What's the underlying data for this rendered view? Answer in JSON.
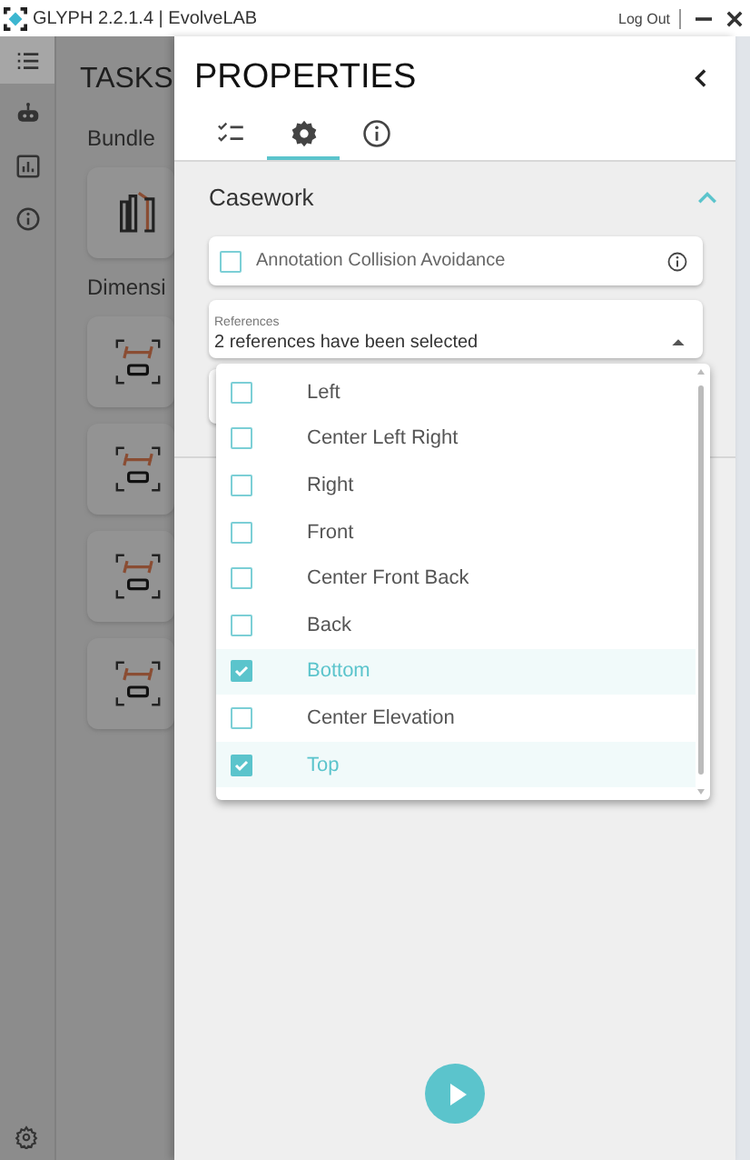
{
  "window": {
    "title": "GLYPH 2.2.1.4 | EvolveLAB",
    "logout": "Log Out"
  },
  "tasks_panel": {
    "title": "TASKS",
    "sections": [
      {
        "title": "Bundle",
        "cards": [
          {
            "kind": "bundle"
          }
        ]
      },
      {
        "title": "Dimensi",
        "cards": [
          {
            "kind": "dimension"
          },
          {
            "kind": "dimension"
          },
          {
            "kind": "dimension"
          },
          {
            "kind": "dimension"
          }
        ]
      }
    ]
  },
  "rail": {
    "items": [
      {
        "kind": "list",
        "selected": true
      },
      {
        "kind": "robot",
        "selected": false
      },
      {
        "kind": "chart",
        "selected": false
      },
      {
        "kind": "info",
        "selected": false
      }
    ]
  },
  "properties": {
    "title": "PROPERTIES",
    "tabs": [
      {
        "kind": "checklist",
        "selected": false
      },
      {
        "kind": "gear",
        "selected": true
      },
      {
        "kind": "info",
        "selected": false
      }
    ],
    "section": {
      "title": "Casework",
      "expanded": true,
      "checkbox": {
        "label": "Annotation Collision Avoidance",
        "checked": false
      },
      "references": {
        "label": "References",
        "value": "2 references have been selected",
        "options": [
          {
            "label": "Left",
            "checked": false
          },
          {
            "label": "Center Left Right",
            "checked": false
          },
          {
            "label": "Right",
            "checked": false
          },
          {
            "label": "Front",
            "checked": false
          },
          {
            "label": "Center Front Back",
            "checked": false
          },
          {
            "label": "Back",
            "checked": false
          },
          {
            "label": "Bottom",
            "checked": true
          },
          {
            "label": "Center Elevation",
            "checked": false
          },
          {
            "label": "Top",
            "checked": true
          }
        ]
      }
    }
  }
}
